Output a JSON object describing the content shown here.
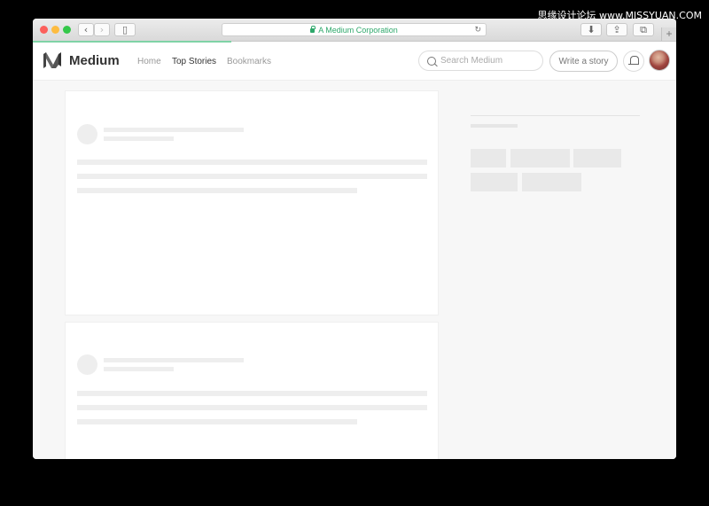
{
  "watermark": "思缘设计论坛 www.MISSYUAN.COM",
  "browser": {
    "address": "A Medium Corporation",
    "reload_glyph": "↻",
    "back_glyph": "‹",
    "forward_glyph": "›",
    "new_tab_glyph": "+",
    "download_glyph": "⬇",
    "share_glyph": "⇪",
    "tabs_glyph": "⧉",
    "sidebar_glyph": "▯",
    "colors": {
      "close": "#fc605c",
      "minimize": "#fdbc40",
      "zoom": "#34c84a",
      "secure": "#2ea86b"
    }
  },
  "nav": {
    "brand": "Medium",
    "links": [
      {
        "label": "Home",
        "active": false
      },
      {
        "label": "Top Stories",
        "active": true
      },
      {
        "label": "Bookmarks",
        "active": false
      }
    ],
    "search_placeholder": "Search Medium",
    "write_label": "Write a story"
  },
  "icons": [
    "lock-icon",
    "reload-icon",
    "search-icon",
    "bell-icon",
    "medium-logo-icon",
    "download-icon",
    "share-icon",
    "tabs-icon",
    "sidebar-icon"
  ]
}
